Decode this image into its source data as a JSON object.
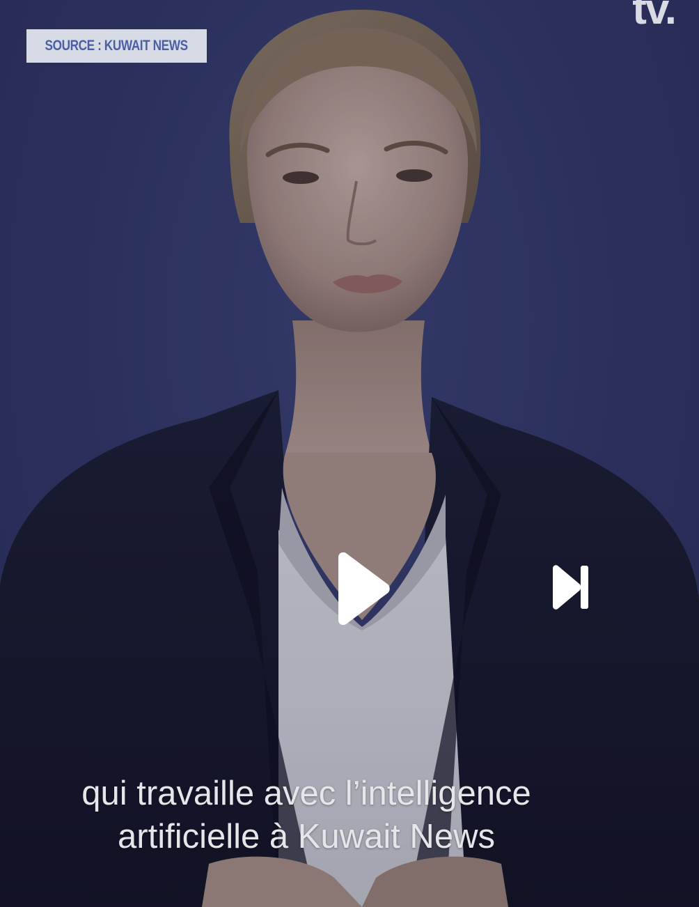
{
  "overlay": {
    "source_label": "SOURCE : KUWAIT NEWS",
    "channel_logo": "tv."
  },
  "controls": {
    "play_icon": "play-icon",
    "skip_icon": "skip-next-icon"
  },
  "subtitles": {
    "line1": "qui travaille avec l’intelligence",
    "line2": "artificielle à Kuwait News"
  },
  "colors": {
    "background": "#343a6c",
    "badge_bg": "#d7dbe6",
    "badge_text": "#4b5fa6",
    "subtitle_text": "#e6e6ea",
    "controls": "#ffffff"
  }
}
